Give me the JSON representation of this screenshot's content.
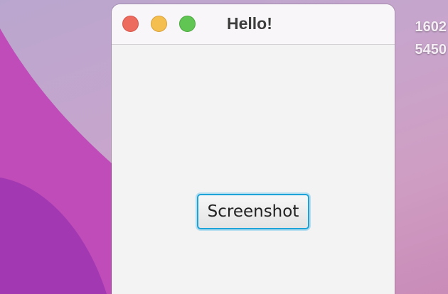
{
  "window": {
    "title": "Hello!"
  },
  "main": {
    "screenshot_label": "Screenshot"
  },
  "desktop": {
    "text_lines": [
      "1602",
      "5450"
    ]
  }
}
